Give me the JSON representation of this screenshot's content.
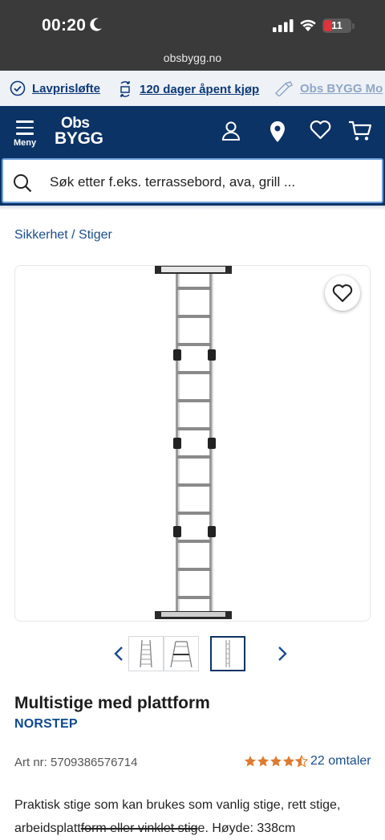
{
  "status_bar": {
    "time": "00:20",
    "battery": "11",
    "url": "obsbygg.no"
  },
  "usp_bar": {
    "items": [
      {
        "label": "Lavprisløfte",
        "icon": "check-circle-icon"
      },
      {
        "label": "120 dager åpent kjøp",
        "icon": "refresh-icon"
      },
      {
        "label": "Obs BYGG Mo",
        "icon": "tools-icon"
      }
    ]
  },
  "header": {
    "menu_label": "Meny",
    "logo_line1": "Obs",
    "logo_line2": "BYGG",
    "icons": [
      "user-icon",
      "location-icon",
      "heart-icon",
      "cart-icon"
    ]
  },
  "search": {
    "placeholder": "Søk etter f.eks. terrassebord, ava, grill ..."
  },
  "breadcrumb": "Sikkerhet / Stiger",
  "product": {
    "title": "Multistige med plattform",
    "brand": "NORSTEP",
    "art_nr": "Art nr: 5709386576714",
    "rating": 4.5,
    "reviews": "22 omtaler",
    "description_part1": "Praktisk stige som kan brukes som vanlig stige, rett stige, arbeidsplatt",
    "description_strike": "form eller vinklet stig",
    "description_part2": "e. Høyde: 338cm"
  },
  "colors": {
    "navy": "#0b3366",
    "link": "#1a4d8f",
    "star": "#e07a2e"
  }
}
